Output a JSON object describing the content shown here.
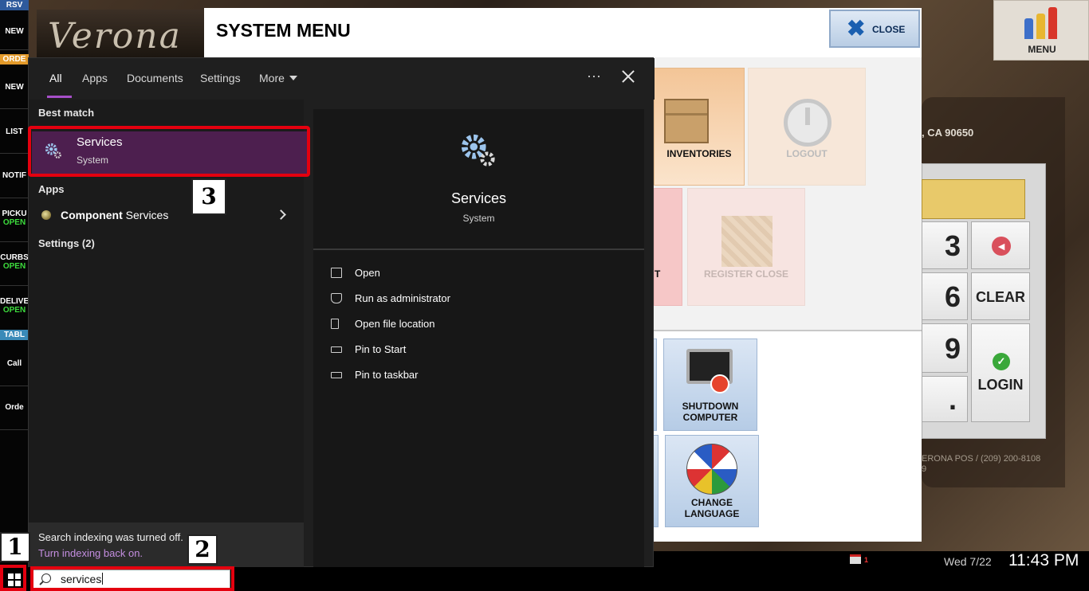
{
  "pos": {
    "logo_text": "Verona",
    "left_rail": {
      "rsv_tag": "RSV",
      "new_1": "NEW",
      "order_tag": "ORDE",
      "new_2": "NEW",
      "list": "LIST",
      "notif": "NOTIF",
      "pickup": "PICKU",
      "pickup_status": "OPEN",
      "curbs": "CURBS",
      "curbs_status": "OPEN",
      "deliver": "DELIVE",
      "deliver_status": "OPEN",
      "table_tag": "TABL",
      "call": "Call",
      "order": "Orde"
    },
    "menu_button": "MENU",
    "system_menu": {
      "title": "SYSTEM MENU",
      "close_label": "CLOSE",
      "tiles": {
        "inventories": "INVENTORIES",
        "logout": "LOGOUT",
        "pink_partial": "T",
        "register_close": "REGISTER CLOSE",
        "shutdown_line1": "SHUTDOWN",
        "shutdown_line2": "COMPUTER",
        "language_line1": "CHANGE",
        "language_line2": "LANGUAGE"
      }
    },
    "login_panel": {
      "address": ", CA 90650",
      "keys": [
        "3",
        "6",
        "9",
        "."
      ],
      "clear": "CLEAR",
      "login": "LOGIN",
      "footer_1": "ERONA POS / (209) 200-8108",
      "footer_2": "9"
    },
    "printer_count": "1",
    "date": "Wed 7/22",
    "time": "11:43 PM"
  },
  "search_flyout": {
    "tabs": [
      {
        "label": "All",
        "active": true
      },
      {
        "label": "Apps"
      },
      {
        "label": "Documents"
      },
      {
        "label": "Settings"
      },
      {
        "label": "More"
      }
    ],
    "more_options": "···",
    "best_match_label": "Best match",
    "best_match": {
      "name": "Services",
      "type": "System"
    },
    "apps_label": "Apps",
    "apps": [
      {
        "name_bold": "Component",
        "name_rest": " Services"
      }
    ],
    "settings_label": "Settings (2)",
    "preview": {
      "title": "Services",
      "subtitle": "System",
      "actions": [
        "Open",
        "Run as administrator",
        "Open file location",
        "Pin to Start",
        "Pin to taskbar"
      ]
    },
    "index_notice": {
      "message": "Search indexing was turned off.",
      "link": "Turn indexing back on."
    }
  },
  "annotations": {
    "step_1": "1",
    "step_2": "2",
    "step_3": "3",
    "highlight_color": "#e4000f"
  },
  "taskbar": {
    "search_value": "services"
  }
}
